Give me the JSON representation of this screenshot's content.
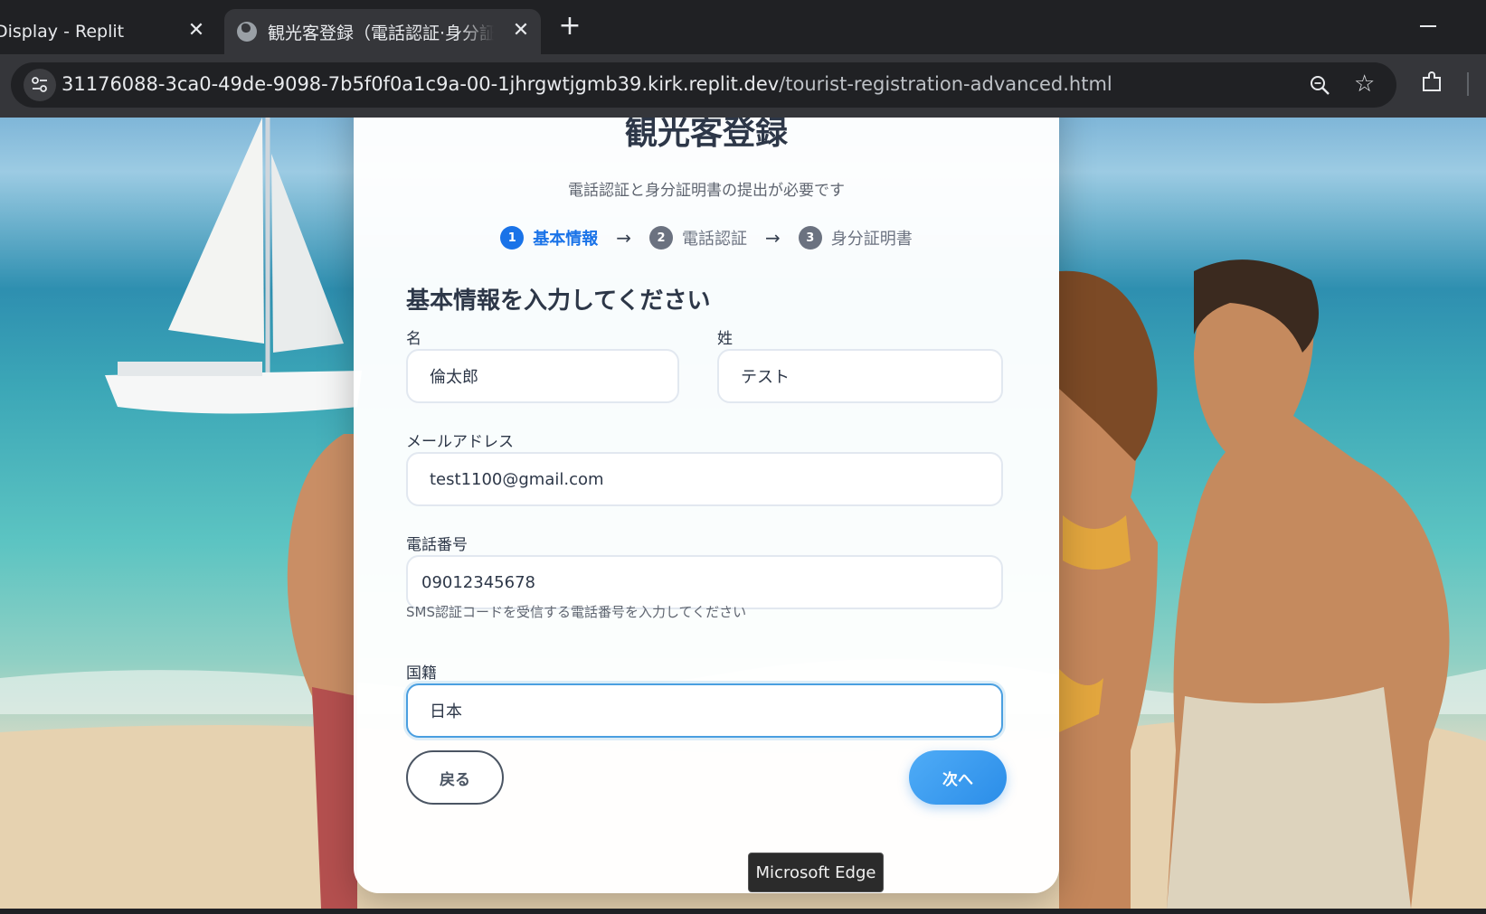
{
  "browser": {
    "tabs": [
      {
        "title": "Display - Replit",
        "active": false
      },
      {
        "title": "観光客登録（電話認証·身分証明書）",
        "active": true
      }
    ],
    "close_glyph": "✕",
    "new_tab_glyph": "+",
    "url_host": "31176088-3ca0-49de-9098-7b5f0f0a1c9a-00-1jhrgwtjgmb39.kirk.replit.dev",
    "url_path": "/tourist-registration-advanced.html",
    "icons": [
      "site-info-icon",
      "globe-icon",
      "zoom-icon",
      "star-icon",
      "extensions-icon"
    ]
  },
  "page": {
    "title": "観光客登録",
    "subtitle": "電話認証と身分証明書の提出が必要です",
    "steps": [
      {
        "num": "1",
        "label": "基本情報",
        "active": true
      },
      {
        "num": "2",
        "label": "電話認証",
        "active": false
      },
      {
        "num": "3",
        "label": "身分証明書",
        "active": false
      }
    ],
    "step_arrow": "→",
    "section_title": "基本情報を入力してください",
    "form": {
      "first_name": {
        "label": "名",
        "value": "倫太郎"
      },
      "last_name": {
        "label": "姓",
        "value": "テスト"
      },
      "email": {
        "label": "メールアドレス",
        "value": "test1100@gmail.com"
      },
      "phone": {
        "label": "電話番号",
        "value": "09012345678",
        "help": "SMS認証コードを受信する電話番号を入力してください"
      },
      "nationality": {
        "label": "国籍",
        "value": "日本",
        "focused": true
      }
    },
    "buttons": {
      "back": "戻る",
      "next": "次へ"
    },
    "colors": {
      "accent": "#1a73e8",
      "next_button": "#2b8de8",
      "focus_border": "#4a9fe0"
    }
  },
  "tooltip": {
    "text": "Microsoft Edge"
  }
}
